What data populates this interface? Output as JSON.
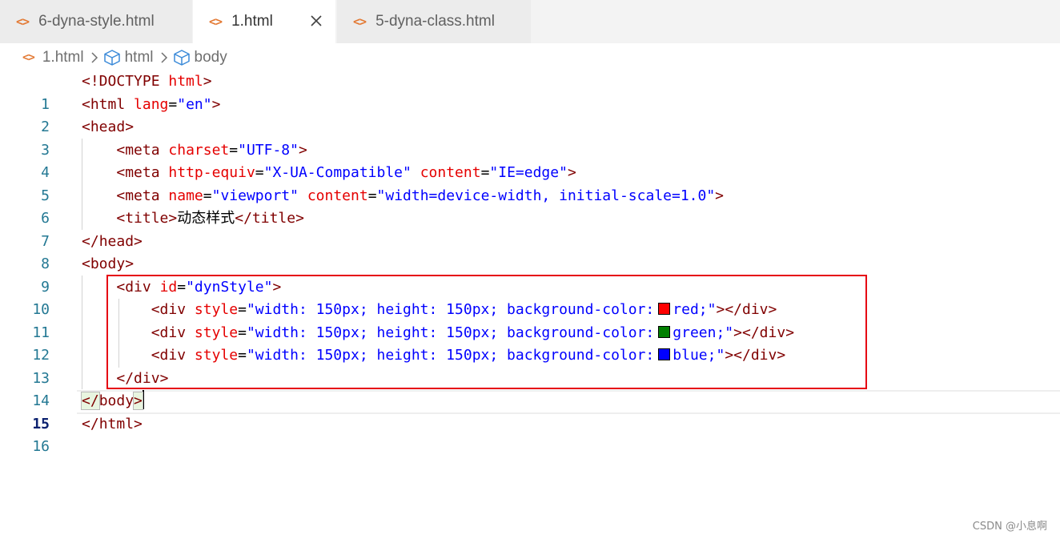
{
  "tabs": [
    {
      "label": "6-dyna-style.html",
      "icon": "html-file-icon",
      "active": false
    },
    {
      "label": "1.html",
      "icon": "html-file-icon",
      "active": true,
      "close_glyph": "×"
    },
    {
      "label": "5-dyna-class.html",
      "icon": "html-file-icon",
      "active": false
    }
  ],
  "breadcrumb": {
    "file": "1.html",
    "items": [
      "html",
      "body"
    ]
  },
  "colors": {
    "tag": "#800000",
    "attribute": "#e50000",
    "value": "#0000ff",
    "line_number": "#237893",
    "highlight_box": "#e60012",
    "swatch_red": "#ff0000",
    "swatch_green": "#008000",
    "swatch_blue": "#0000ff"
  },
  "editor": {
    "current_line": 15,
    "lines": [
      {
        "n": "1"
      },
      {
        "n": "2"
      },
      {
        "n": "3"
      },
      {
        "n": "4"
      },
      {
        "n": "5"
      },
      {
        "n": "6"
      },
      {
        "n": "7"
      },
      {
        "n": "8"
      },
      {
        "n": "9"
      },
      {
        "n": "10"
      },
      {
        "n": "11"
      },
      {
        "n": "12"
      },
      {
        "n": "13"
      },
      {
        "n": "14"
      },
      {
        "n": "15"
      },
      {
        "n": "16"
      }
    ],
    "tokens": {
      "doctype_open": "<!DOCTYPE ",
      "doctype_html": "html",
      "gt": ">",
      "lt": "<",
      "lt_slash": "</",
      "eq": "=",
      "html": "html",
      "lang": "lang",
      "en": "\"en\"",
      "head": "head",
      "meta": "meta",
      "charset": "charset",
      "utf8": "\"UTF-8\"",
      "http_equiv": "http-equiv",
      "xua": "\"X-UA-Compatible\"",
      "content": "content",
      "ie_edge": "\"IE=edge\"",
      "name": "name",
      "viewport": "\"viewport\"",
      "viewport_content": "\"width=device-width, initial-scale=1.0\"",
      "title": "title",
      "title_text": "动态样式",
      "body": "body",
      "div": "div",
      "id": "id",
      "dyn_style": "\"dynStyle\"",
      "style": "style",
      "style_prefix": "\"width: 150px; height: 150px; background-color:",
      "red_val": "red;\"",
      "green_val": "green;\"",
      "blue_val": "blue;\""
    }
  },
  "watermark": "CSDN @小息啊"
}
